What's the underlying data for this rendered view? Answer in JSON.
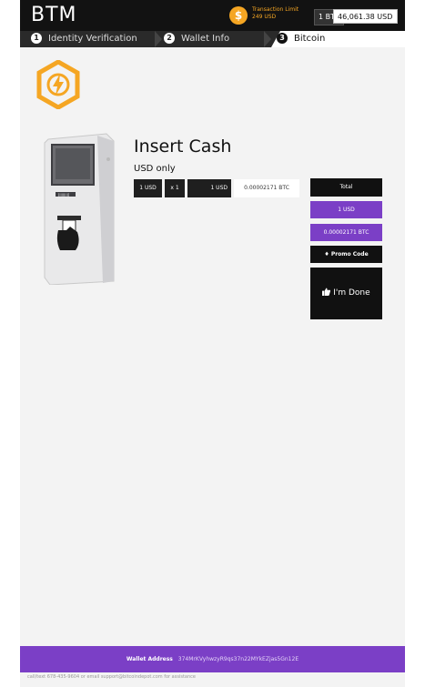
{
  "header": {
    "brand": "BTM",
    "limit_icon": "$",
    "limit_title": "Transaction Limit",
    "limit_value": "249 USD",
    "rate_btc": "1 BTC",
    "rate_usd": "46,061.38 USD"
  },
  "steps": [
    {
      "num": "1",
      "label": "Identity Verification"
    },
    {
      "num": "2",
      "label": "Wallet Info"
    },
    {
      "num": "3",
      "label": "Bitcoin"
    }
  ],
  "main": {
    "title": "Insert Cash",
    "subtitle": "USD only",
    "row": {
      "denomination": "1 USD",
      "multiplier": "x 1",
      "subtotal": "1 USD",
      "btc": "0.00002171 BTC"
    }
  },
  "sidebar": {
    "total_label": "Total",
    "total_usd": "1 USD",
    "total_btc": "0.00002171 BTC",
    "promo_label": "Promo Code",
    "done_label": "I'm Done"
  },
  "atm": {
    "dispenser_label": "[||||||||]"
  },
  "footer": {
    "wallet_label": "Wallet Address",
    "wallet_address": "374MrKVyhwzyR9qs37n22MYkEZjas5Gn12E",
    "assistance": "call/text 678-435-9604 or email support@bitcoindepot.com for assistance"
  },
  "colors": {
    "accent_purple": "#7b3fc6",
    "limit_orange": "#f5a623",
    "logo_orange": "#f5a623"
  },
  "icons": {
    "logo": "hexagon-lightning-logo",
    "limit": "dollar-coin-icon",
    "promo": "tag-icon",
    "done": "thumbs-up-icon"
  }
}
